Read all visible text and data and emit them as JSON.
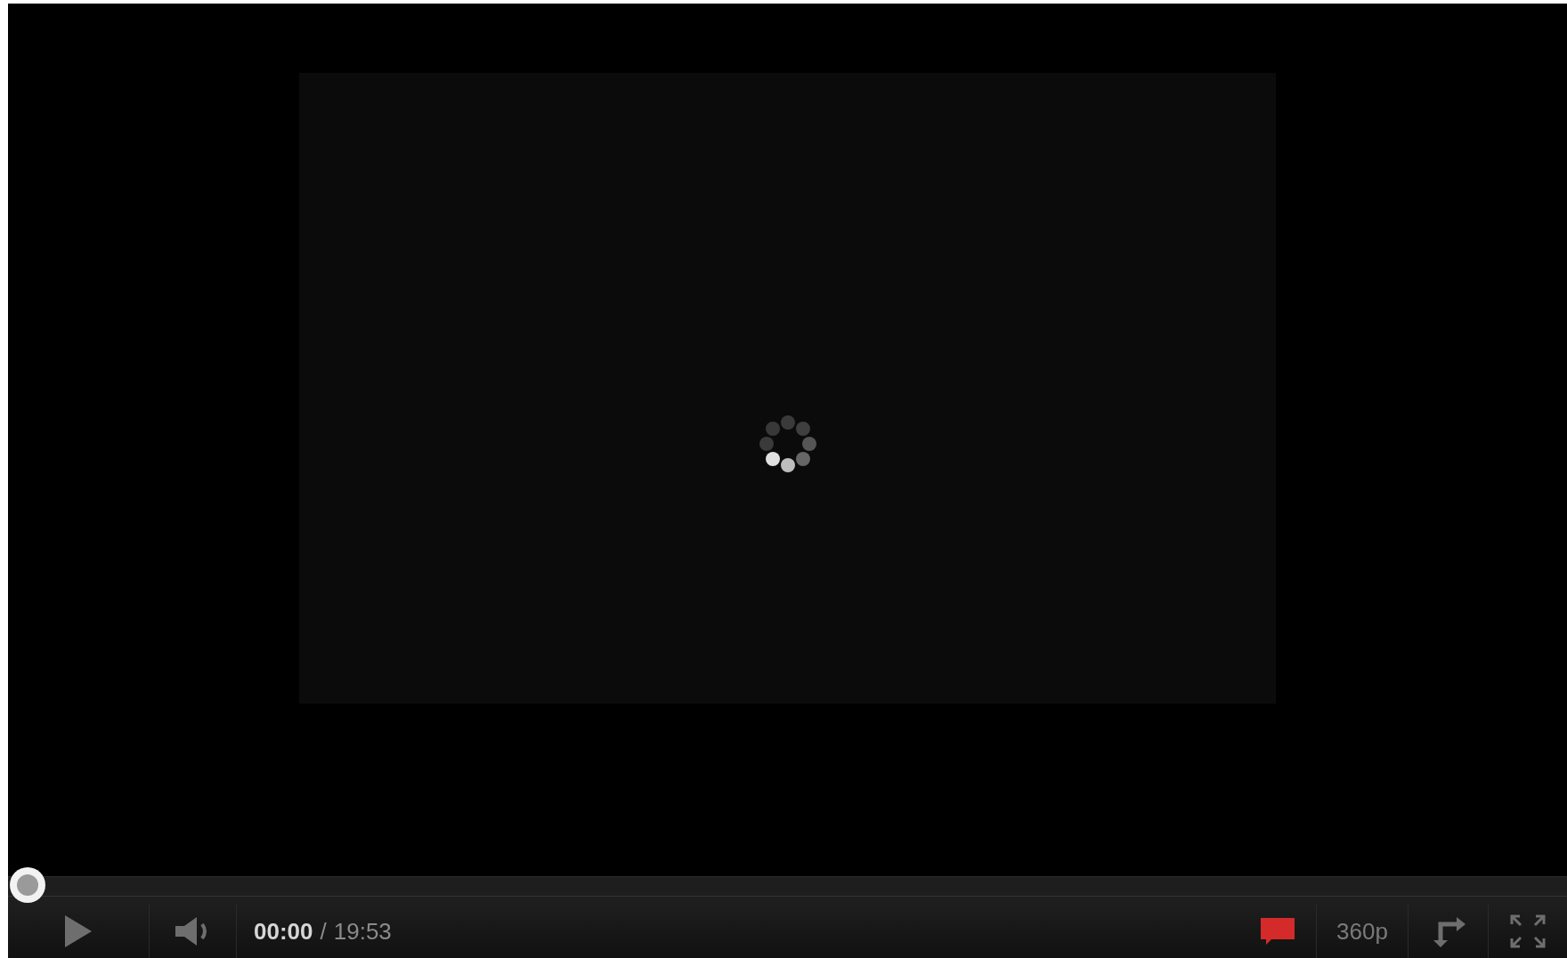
{
  "player": {
    "loading": true,
    "progress": {
      "level": 0
    },
    "play_button": {
      "playing": false
    },
    "volume": {
      "muted": false
    },
    "time": {
      "current": "00:00",
      "separator": "/",
      "duration": "19:53"
    },
    "captions": {
      "on": true
    },
    "quality": "360p"
  }
}
